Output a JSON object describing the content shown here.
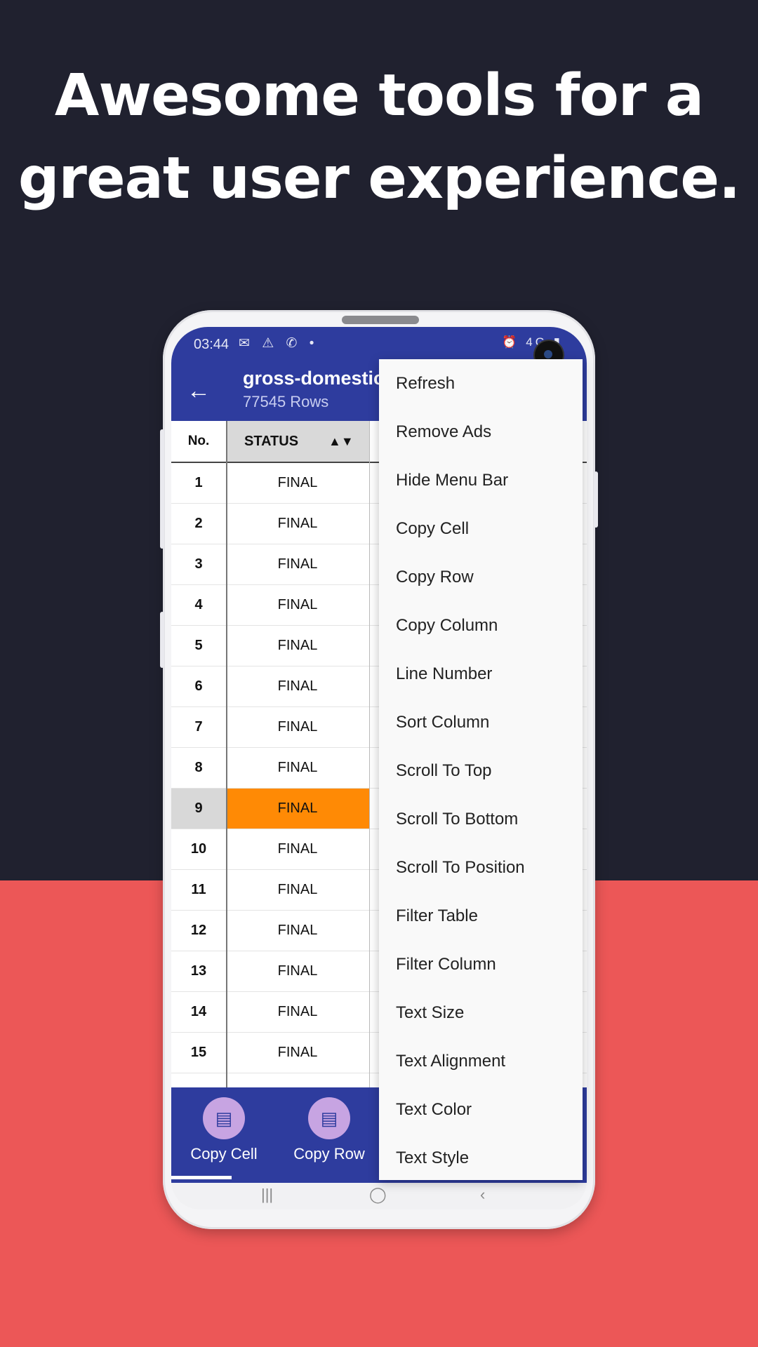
{
  "headline": {
    "line1": "Awesome tools for a",
    "line2": "great user experience."
  },
  "colors": {
    "top_bg": "#20212f",
    "bottom_bg": "#ec5757",
    "app_bar": "#2e3c9e",
    "selected_cell": "#ff8a05",
    "button_circle": "#c7a4e2"
  },
  "status_bar": {
    "time": "03:44",
    "left_icons": "✉ ⚠ ✆ •",
    "right_icons": "⏰ 4G ▮"
  },
  "app_bar": {
    "back_icon": "←",
    "title": "gross-domestic",
    "subtitle": "77545 Rows"
  },
  "table": {
    "columns": [
      "No.",
      "STATUS"
    ],
    "sort_icon": "▲▼",
    "rows": [
      {
        "no": "1",
        "status": "FINAL"
      },
      {
        "no": "2",
        "status": "FINAL"
      },
      {
        "no": "3",
        "status": "FINAL"
      },
      {
        "no": "4",
        "status": "FINAL"
      },
      {
        "no": "5",
        "status": "FINAL"
      },
      {
        "no": "6",
        "status": "FINAL"
      },
      {
        "no": "7",
        "status": "FINAL"
      },
      {
        "no": "8",
        "status": "FINAL"
      },
      {
        "no": "9",
        "status": "FINAL"
      },
      {
        "no": "10",
        "status": "FINAL"
      },
      {
        "no": "11",
        "status": "FINAL"
      },
      {
        "no": "12",
        "status": "FINAL"
      },
      {
        "no": "13",
        "status": "FINAL"
      },
      {
        "no": "14",
        "status": "FINAL"
      },
      {
        "no": "15",
        "status": "FINAL"
      }
    ],
    "selected_row": "9"
  },
  "bottom_bar": {
    "items": [
      {
        "label": "Copy Cell",
        "icon": "copy-cell-icon"
      },
      {
        "label": "Copy Row",
        "icon": "copy-row-icon"
      }
    ]
  },
  "nav_bar": {
    "recents": "|||",
    "home": "◯",
    "back": "‹"
  },
  "menu": {
    "items": [
      "Refresh",
      "Remove Ads",
      "Hide Menu Bar",
      "Copy Cell",
      "Copy Row",
      "Copy Column",
      "Line Number",
      "Sort Column",
      "Scroll To Top",
      "Scroll To Bottom",
      "Scroll To Position",
      "Filter Table",
      "Filter Column",
      "Text Size",
      "Text Alignment",
      "Text Color",
      "Text Style"
    ]
  }
}
